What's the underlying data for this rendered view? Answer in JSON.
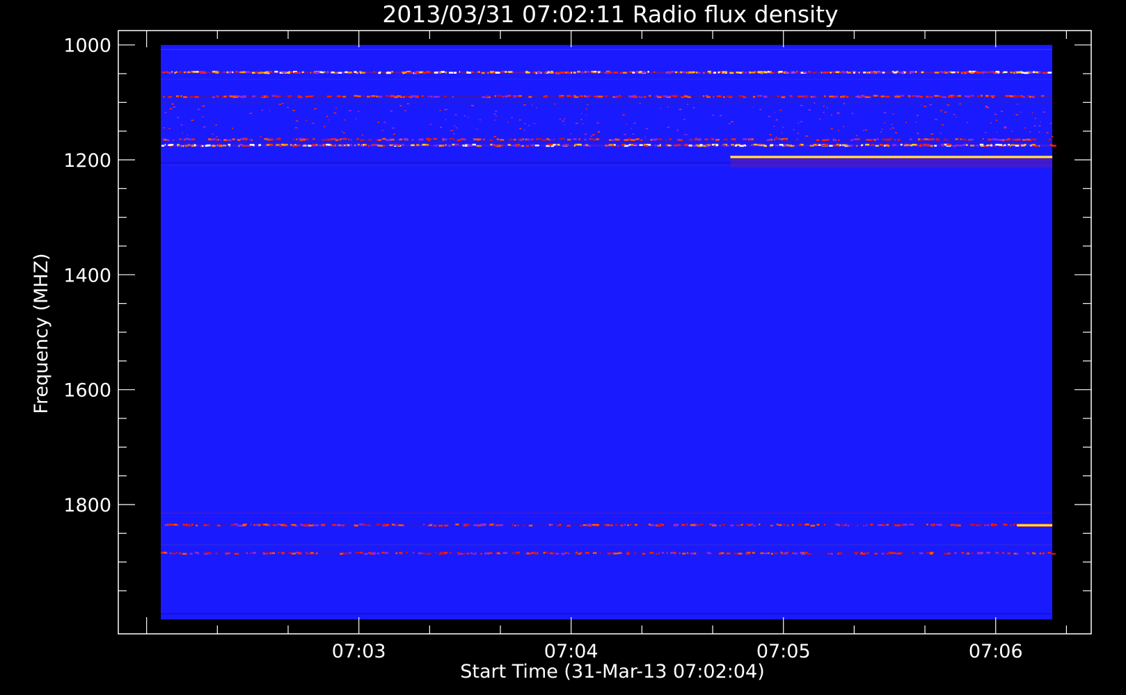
{
  "chart_data": {
    "type": "heatmap",
    "title": "2013/03/31 07:02:11 Radio flux density",
    "xlabel": "Start Time (31-Mar-13 07:02:04)",
    "ylabel": "Frequency (MHZ)",
    "x_ticks": [
      "07:03",
      "07:04",
      "07:05",
      "07:06"
    ],
    "y_ticks": [
      "1000",
      "1200",
      "1400",
      "1600",
      "1800"
    ],
    "y_tick_values": [
      1000,
      1200,
      1400,
      1600,
      1800
    ],
    "ylim": [
      1000,
      2000
    ],
    "y_axis_inverted": true,
    "x_range": [
      "07:02:04",
      "07:06:16"
    ],
    "frame_x_range": [
      "07:01:52",
      "07:06:27"
    ],
    "frame_y_range": [
      975,
      2025
    ],
    "background_color": "#1a1aff",
    "colormap": [
      "#000000",
      "#1a1aff",
      "#8a2be2",
      "#ff2000",
      "#ff8c00",
      "#ffff66",
      "#ffffff"
    ],
    "bands": [
      {
        "freq_mhz": 1048,
        "intensity": "high",
        "start": "07:02:04",
        "end": "07:06:16"
      },
      {
        "freq_mhz": 1090,
        "intensity": "medium",
        "start": "07:02:04",
        "end": "07:06:16"
      },
      {
        "freq_mhz": 1165,
        "intensity": "medium",
        "start": "07:02:04",
        "end": "07:06:16"
      },
      {
        "freq_mhz": 1175,
        "intensity": "high",
        "start": "07:02:04",
        "end": "07:06:16"
      },
      {
        "freq_mhz": 1195,
        "intensity": "very-high",
        "start": "07:04:45",
        "end": "07:06:16"
      },
      {
        "freq_mhz": 1836,
        "intensity": "medium",
        "start": "07:02:04",
        "end": "07:06:16"
      },
      {
        "freq_mhz": 1836,
        "intensity": "very-high",
        "start": "07:06:06",
        "end": "07:06:16"
      },
      {
        "freq_mhz": 1885,
        "intensity": "medium",
        "start": "07:02:04",
        "end": "07:06:16"
      }
    ]
  }
}
